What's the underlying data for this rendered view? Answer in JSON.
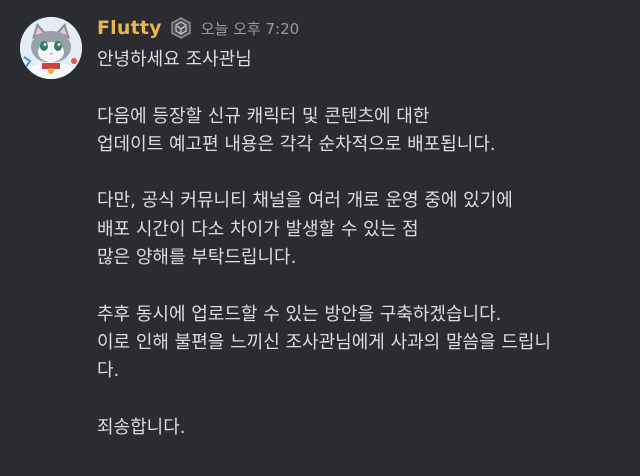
{
  "message": {
    "author": "Flutty",
    "role_badge_icon": "guild-emblem-icon",
    "timestamp": "오늘 오후 7:20",
    "username_color": "#e9b74a",
    "lines": [
      "안녕하세요 조사관님",
      "",
      "다음에 등장할 신규 캐릭터 및 콘텐츠에 대한",
      "업데이트 예고편 내용은 각각 순차적으로 배포됩니다.",
      "",
      "다만, 공식 커뮤니티 채널을 여러 개로 운영 중에 있기에",
      "배포 시간이 다소 차이가 발생할 수 있는 점",
      "많은 양해를 부탁드립니다.",
      "",
      "추후 동시에 업로드할 수 있는 방안을 구축하겠습니다.",
      "이로 인해 불편을 느끼신 조사관님에게 사과의 말씀을 드립니",
      "다.",
      "",
      "죄송합니다."
    ]
  }
}
